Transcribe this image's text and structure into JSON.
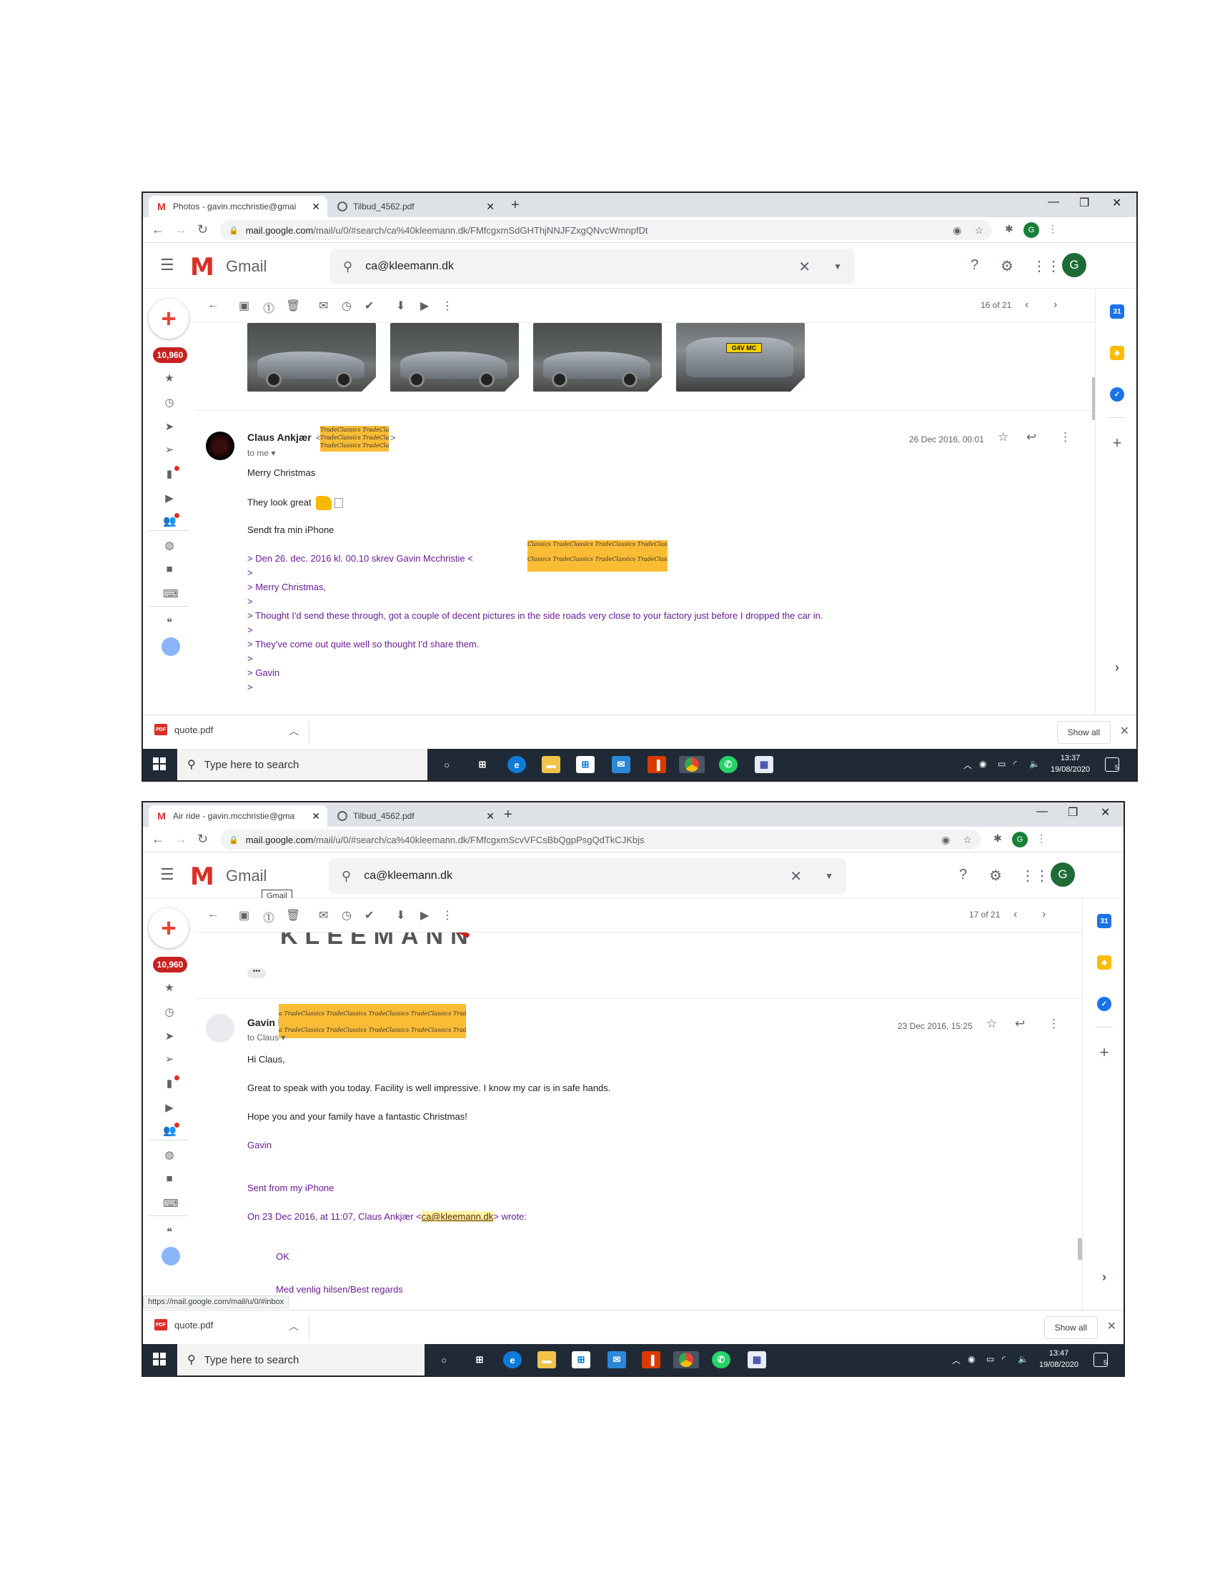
{
  "screenshot1": {
    "tabs": [
      {
        "title": "Photos - gavin.mcchristie@gmai",
        "type": "gmail"
      },
      {
        "title": "Tilbud_4562.pdf",
        "type": "pdf"
      }
    ],
    "url_host": "mail.google.com",
    "url_path": "/mail/u/0/#search/ca%40kleemann.dk/FMfcgxmSdGHThjNNJFZxgQNvcWmnpfDt",
    "search_query": "ca@kleemann.dk",
    "gmail_label": "Gmail",
    "unread_count": "10,960",
    "pager": "16 of 21",
    "plate_text": "G4V MC",
    "sender_name": "Claus Ankjær",
    "sender_email_prefix": "<c",
    "sender_email_suffix": ">",
    "redact_text": "TradeClassics TradeClassics",
    "to_me": "to me",
    "date": "26 Dec 2016, 00:01",
    "body": [
      "Merry Christmas",
      "They look great",
      "Sendt fra min iPhone"
    ],
    "quoted_header": "> Den 26. dec. 2016 kl. 00.10 skrev Gavin Mcchristie <",
    "quoted_redact": "Classics TradeClassics TradeClassics TradeClassics Trade",
    "quoted": [
      ">",
      "> Merry Christmas,",
      ">",
      "> Thought I'd send these through, got a couple of decent pictures in the side roads very close to your factory just before I dropped the car in.",
      ">",
      "> They've come out quite well so thought I'd share them.",
      ">",
      "> Gavin",
      ">"
    ],
    "download_file": "quote.pdf",
    "show_all": "Show all",
    "taskbar_search": "Type here to search",
    "clock_time": "13:37",
    "clock_date": "19/08/2020",
    "notif_count": "5"
  },
  "screenshot2": {
    "tabs": [
      {
        "title": "Air ride - gavin.mcchristie@gma",
        "type": "gmail"
      },
      {
        "title": "Tilbud_4562.pdf",
        "type": "pdf"
      }
    ],
    "url_host": "mail.google.com",
    "url_path": "/mail/u/0/#search/ca%40kleemann.dk/FMfcgxmScvVFCsBbQgpPsgQdTkCJKbjs",
    "search_query": "ca@kleemann.dk",
    "gmail_label": "Gmail",
    "tooltip": "Gmail",
    "unread_count": "10,960",
    "pager": "17 of 21",
    "logo_text": "KLEEMANN",
    "ellipsis": "•••",
    "sender_name": "Gavin I",
    "redact_text": "a TradeClassics TradeClassics TradeClassics TradeClassics TradeClassics Tr",
    "to_claus": "to Claus",
    "date": "23 Dec 2016, 15:25",
    "body": [
      "Hi Claus,",
      "Great to speak with you today. Facility is well impressive. I know my car is in safe hands.",
      "Hope you and your family have a fantastic Christmas!"
    ],
    "signoff": "Gavin",
    "sent_from": "Sent from my iPhone",
    "wrote_prefix": "On 23 Dec 2016, at 11:07, Claus Ankjær <",
    "wrote_email": "ca@kleemann.dk",
    "wrote_suffix": "> wrote:",
    "reply_ok": "OK",
    "regards": "Med venlig hilsen/Best regards",
    "status_url": "https://mail.google.com/mail/u/0/#inbox",
    "download_file": "quote.pdf",
    "show_all": "Show all",
    "taskbar_search": "Type here to search",
    "clock_time": "13:47",
    "clock_date": "19/08/2020",
    "notif_count": "5"
  },
  "colors": {
    "gmail_red": "#d93025",
    "badge_red": "#c5221f",
    "redaction": "#fbbc35",
    "quoted_purple": "#6a1b9a",
    "taskbar": "#202a36"
  }
}
